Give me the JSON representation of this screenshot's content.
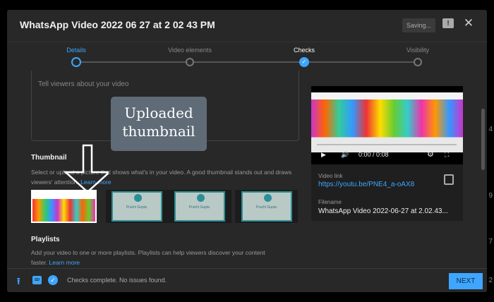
{
  "header": {
    "title": "WhatsApp Video 2022 06 27 at 2 02 43 PM",
    "saving": "Saving...",
    "feedback_icon": "feedback-icon",
    "close_icon": "close-icon"
  },
  "steps": [
    {
      "label": "Details",
      "state": "current"
    },
    {
      "label": "Video elements",
      "state": "pending"
    },
    {
      "label": "Checks",
      "state": "done"
    },
    {
      "label": "Visibility",
      "state": "pending"
    }
  ],
  "description": {
    "placeholder": "Tell viewers about your video"
  },
  "thumbnail": {
    "heading": "Thumbnail",
    "text": "Select or upload a picture that shows what's in your video. A good thumbnail stands out and draws viewers' attention.",
    "learn_more": "Learn more",
    "cert_name": "Prachi Gupta",
    "selected": 0
  },
  "annotation": {
    "line1": "Uploaded",
    "line2": "thumbnail"
  },
  "playlists": {
    "heading": "Playlists",
    "text": "Add your video to one or more playlists. Playlists can help viewers discover your content faster.",
    "learn_more": "Learn more"
  },
  "video": {
    "time": "0:00 / 0:08",
    "link_label": "Video link",
    "link": "https://youtu.be/PNE4_a-oAX8",
    "filename_label": "Filename",
    "filename": "WhatsApp Video 2022-06-27 at 2.02.43..."
  },
  "footer": {
    "status": "Checks complete. No issues found.",
    "next": "NEXT",
    "sd_badge": "SD"
  },
  "background_digits": [
    "4",
    "9",
    "7",
    "2"
  ],
  "colors": {
    "accent": "#3ea6ff",
    "dialog": "#282828"
  }
}
